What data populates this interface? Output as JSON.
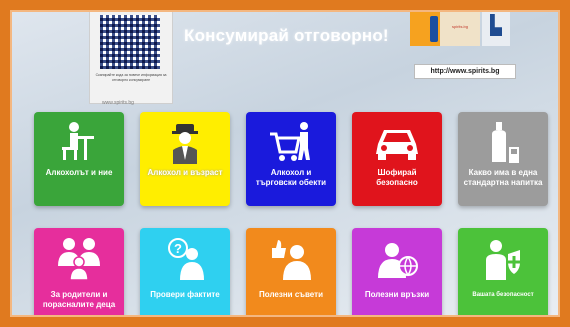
{
  "header": {
    "slogan": "Консумирай отговорно!",
    "url": "http://www.spirits.bg",
    "qr_caption": "Сканирайте кода за повече информация за отговорно консумиране",
    "qr_url": "www.spirits.bg",
    "logo_text": "spirits.bg"
  },
  "colors": {
    "frame": "#e07a1f",
    "green": "#3aa53a",
    "yellow": "#ffee00",
    "blue": "#1a1adc",
    "red": "#e0141c",
    "gray": "#9c9c9c",
    "magenta": "#e62e9c",
    "cyan": "#2fd0f0",
    "orange": "#f28a1c",
    "violet": "#c63ad8",
    "lime": "#4cc23a"
  },
  "tiles": [
    {
      "label": "Алкохолът и ние",
      "icon": "person-at-desk-icon"
    },
    {
      "label": "Алкохол и възраст",
      "icon": "man-with-hat-icon"
    },
    {
      "label": "Алкохол и търговски обекти",
      "icon": "shopping-cart-icon"
    },
    {
      "label": "Шофирай безопасно",
      "icon": "car-icon"
    },
    {
      "label": "Какво има в една стандартна напитка",
      "icon": "bottle-glass-icon"
    },
    {
      "label": "За родители и порасналите деца",
      "icon": "family-icon"
    },
    {
      "label": "Провери фактите",
      "icon": "question-person-icon"
    },
    {
      "label": "Полезни съвети",
      "icon": "thumbs-up-person-icon"
    },
    {
      "label": "Полезни връзки",
      "icon": "globe-person-icon"
    },
    {
      "label": "Вашата безопасност",
      "icon": "shield-person-icon"
    }
  ]
}
